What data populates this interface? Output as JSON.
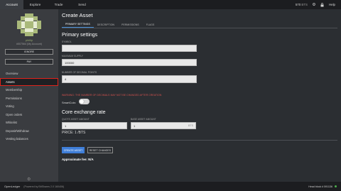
{
  "topbar": {
    "nav": [
      "Account",
      "Explore",
      "Trade",
      "Send"
    ],
    "balance": "570",
    "balance_unit": "BTS",
    "help_label": "Help"
  },
  "sidebar": {
    "account_name": "phillip",
    "account_id": "#507564 (My Account)",
    "buttons": [
      "IGNORE",
      "PAY"
    ],
    "menu": [
      "Overview",
      "Assets",
      "Membership",
      "Permissions",
      "Voting",
      "Open orders",
      "Whitelist",
      "Deposit/Withdraw",
      "Vesting balances"
    ]
  },
  "main": {
    "title": "Create Asset",
    "tabs": [
      "PRIMARY SETTINGS",
      "DESCRIPTION",
      "PERMISSIONS",
      "FLAGS"
    ],
    "primary": {
      "title": "Primary settings",
      "symbol_label": "SYMBOL",
      "symbol_value": "",
      "max_supply_label": "MAXIMUM SUPPLY",
      "max_supply_value": "100000",
      "decimals_label": "NUMBER OF DECIMAL POINTS",
      "decimals_value": "4",
      "warning": "WARNING: THE NUMBER OF DECIMALS MAY NOT BE CHANGED AFTER CREATION",
      "smartcoin_label": "SmartCoin:",
      "smartcoin_on": false
    },
    "exchange": {
      "title": "Core exchange rate",
      "quote_label": "QUOTE ASSET AMOUNT",
      "quote_value": "1",
      "base_label": "BASE ASSET AMOUNT",
      "base_value": "1",
      "base_unit": "BTS",
      "price": "PRICE: 1 /BTS"
    },
    "buttons": {
      "create": "CREATE ASSET",
      "reset": "RESET CHANGES"
    },
    "approximate_fee": "Approximate fee: N/A"
  },
  "footer": {
    "brand": "OpenLedger",
    "powered": "(Powered by BitShares 2.0 160406)",
    "head_block": "Head block # 591136"
  },
  "colors": {
    "accent": "#3f7ed8",
    "warning": "#d9534f",
    "highlight": "#e0231b"
  }
}
